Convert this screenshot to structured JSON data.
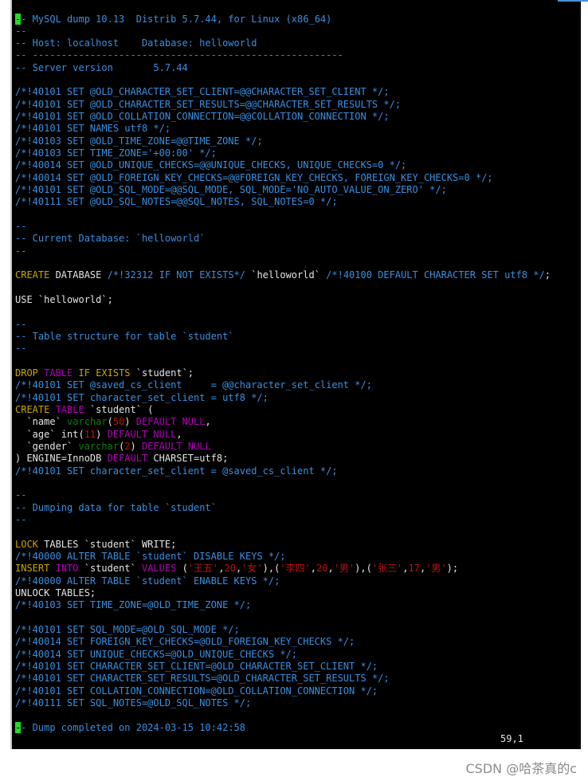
{
  "colors": {
    "comment": "#3a8fe0",
    "keyword": "#c8a400",
    "type": "#b000b8",
    "datatype": "#0a7a0a",
    "number": "#c01010",
    "text": "#e4e4e4",
    "cursor": "#22dd22",
    "background": "#000000"
  },
  "editor": {
    "lines": [
      [
        [
          "-",
          "c cursor"
        ],
        [
          "- MySQL dump 10.13  Distrib 5.7.44, for Linux (x86_64)",
          "c"
        ]
      ],
      [
        [
          "--",
          "c"
        ]
      ],
      [
        [
          "-- Host: localhost    Database: helloworld",
          "c"
        ]
      ],
      [
        [
          "-- ------------------------------------------------------",
          "c"
        ]
      ],
      [
        [
          "-- Server version       5.7.44",
          "c"
        ]
      ],
      [],
      [
        [
          "/*!40101 SET @OLD_CHARACTER_SET_CLIENT=@@CHARACTER_SET_CLIENT */;",
          "c"
        ]
      ],
      [
        [
          "/*!40101 SET @OLD_CHARACTER_SET_RESULTS=@@CHARACTER_SET_RESULTS */;",
          "c"
        ]
      ],
      [
        [
          "/*!40101 SET @OLD_COLLATION_CONNECTION=@@COLLATION_CONNECTION */;",
          "c"
        ]
      ],
      [
        [
          "/*!40101 SET NAMES utf8 */;",
          "c"
        ]
      ],
      [
        [
          "/*!40103 SET @OLD_TIME_ZONE=@@TIME_ZONE */;",
          "c"
        ]
      ],
      [
        [
          "/*!40103 SET TIME_ZONE='+00:00' */;",
          "c"
        ]
      ],
      [
        [
          "/*!40014 SET @OLD_UNIQUE_CHECKS=@@UNIQUE_CHECKS, UNIQUE_CHECKS=0 */;",
          "c"
        ]
      ],
      [
        [
          "/*!40014 SET @OLD_FOREIGN_KEY_CHECKS=@@FOREIGN_KEY_CHECKS, FOREIGN_KEY_CHECKS=0 */;",
          "c"
        ]
      ],
      [
        [
          "/*!40101 SET @OLD_SQL_MODE=@@SQL_MODE, SQL_MODE='NO_AUTO_VALUE_ON_ZERO' */;",
          "c"
        ]
      ],
      [
        [
          "/*!40111 SET @OLD_SQL_NOTES=@@SQL_NOTES, SQL_NOTES=0 */;",
          "c"
        ]
      ],
      [],
      [
        [
          "--",
          "c"
        ]
      ],
      [
        [
          "-- Current Database: `helloworld`",
          "c"
        ]
      ],
      [
        [
          "--",
          "c"
        ]
      ],
      [],
      [
        [
          "CREATE",
          "k"
        ],
        [
          " DATABASE ",
          "p"
        ],
        [
          "/*!32312 IF NOT EXISTS*/",
          "c"
        ],
        [
          " `helloworld` ",
          "p"
        ],
        [
          "/*!40100 DEFAULT CHARACTER SET utf8 */",
          "c"
        ],
        [
          ";",
          "p"
        ]
      ],
      [],
      [
        [
          "USE `helloworld`;",
          "p"
        ]
      ],
      [],
      [
        [
          "--",
          "c"
        ]
      ],
      [
        [
          "-- Table structure for table `student`",
          "c"
        ]
      ],
      [
        [
          "--",
          "c"
        ]
      ],
      [],
      [
        [
          "DROP",
          "k"
        ],
        [
          " ",
          "p"
        ],
        [
          "TABLE",
          "t"
        ],
        [
          " ",
          "p"
        ],
        [
          "IF",
          "k"
        ],
        [
          " ",
          "p"
        ],
        [
          "EXISTS",
          "k"
        ],
        [
          " `student`;",
          "p"
        ]
      ],
      [
        [
          "/*!40101 SET @saved_cs_client     = @@character_set_client */;",
          "c"
        ]
      ],
      [
        [
          "/*!40101 SET character_set_client = utf8 */;",
          "c"
        ]
      ],
      [
        [
          "CREATE",
          "k"
        ],
        [
          " ",
          "p"
        ],
        [
          "TABLE",
          "t"
        ],
        [
          " `student` (",
          "p"
        ]
      ],
      [
        [
          "  `name` ",
          "p"
        ],
        [
          "varchar",
          "g"
        ],
        [
          "(",
          "p"
        ],
        [
          "50",
          "n"
        ],
        [
          ") ",
          "p"
        ],
        [
          "DEFAULT NULL",
          "t"
        ],
        [
          ",",
          "p"
        ]
      ],
      [
        [
          "  `age` int(",
          "p"
        ],
        [
          "11",
          "n"
        ],
        [
          ") ",
          "p"
        ],
        [
          "DEFAULT NULL",
          "t"
        ],
        [
          ",",
          "p"
        ]
      ],
      [
        [
          "  `gender` ",
          "p"
        ],
        [
          "varchar",
          "g"
        ],
        [
          "(",
          "p"
        ],
        [
          "2",
          "n"
        ],
        [
          ") ",
          "p"
        ],
        [
          "DEFAULT NULL",
          "t"
        ]
      ],
      [
        [
          ") ENGINE=InnoDB ",
          "p"
        ],
        [
          "DEFAULT",
          "t"
        ],
        [
          " CHARSET=utf8;",
          "p"
        ]
      ],
      [
        [
          "/*!40101 SET character_set_client = @saved_cs_client */;",
          "c"
        ]
      ],
      [],
      [
        [
          "--",
          "c"
        ]
      ],
      [
        [
          "-- Dumping data for table `student`",
          "c"
        ]
      ],
      [
        [
          "--",
          "c"
        ]
      ],
      [],
      [
        [
          "LOCK",
          "k"
        ],
        [
          " TABLES `student` WRITE;",
          "p"
        ]
      ],
      [
        [
          "/*!40000 ALTER TABLE `student` DISABLE KEYS */;",
          "c"
        ]
      ],
      [
        [
          "INSERT",
          "k"
        ],
        [
          " ",
          "p"
        ],
        [
          "INTO",
          "t"
        ],
        [
          " `student` ",
          "p"
        ],
        [
          "VALUES",
          "t"
        ],
        [
          " (",
          "p"
        ],
        [
          "'王五'",
          "n"
        ],
        [
          ",",
          "p"
        ],
        [
          "20",
          "n"
        ],
        [
          ",",
          "p"
        ],
        [
          "'女'",
          "n"
        ],
        [
          "),(",
          "p"
        ],
        [
          "'李四'",
          "n"
        ],
        [
          ",",
          "p"
        ],
        [
          "20",
          "n"
        ],
        [
          ",",
          "p"
        ],
        [
          "'男'",
          "n"
        ],
        [
          "),(",
          "p"
        ],
        [
          "'张三'",
          "n"
        ],
        [
          ",",
          "p"
        ],
        [
          "17",
          "n"
        ],
        [
          ",",
          "p"
        ],
        [
          "'男'",
          "n"
        ],
        [
          ");",
          "p"
        ]
      ],
      [
        [
          "/*!40000 ALTER TABLE `student` ENABLE KEYS */;",
          "c"
        ]
      ],
      [
        [
          "UNLOCK TABLES;",
          "p"
        ]
      ],
      [
        [
          "/*!40103 SET TIME_ZONE=@OLD_TIME_ZONE */;",
          "c"
        ]
      ],
      [],
      [
        [
          "/*!40101 SET SQL_MODE=@OLD_SQL_MODE */;",
          "c"
        ]
      ],
      [
        [
          "/*!40014 SET FOREIGN_KEY_CHECKS=@OLD_FOREIGN_KEY_CHECKS */;",
          "c"
        ]
      ],
      [
        [
          "/*!40014 SET UNIQUE_CHECKS=@OLD_UNIQUE_CHECKS */;",
          "c"
        ]
      ],
      [
        [
          "/*!40101 SET CHARACTER_SET_CLIENT=@OLD_CHARACTER_SET_CLIENT */;",
          "c"
        ]
      ],
      [
        [
          "/*!40101 SET CHARACTER_SET_RESULTS=@OLD_CHARACTER_SET_RESULTS */;",
          "c"
        ]
      ],
      [
        [
          "/*!40101 SET COLLATION_CONNECTION=@OLD_COLLATION_CONNECTION */;",
          "c"
        ]
      ],
      [
        [
          "/*!40111 SET SQL_NOTES=@OLD_SQL_NOTES */;",
          "c"
        ]
      ],
      [],
      [
        [
          "-",
          "c cursor"
        ],
        [
          "- Dump completed on 2024-03-15 10:42:58",
          "c"
        ]
      ]
    ],
    "cursor_position": "59,1"
  },
  "watermark": "CSDN @哈茶真的c"
}
